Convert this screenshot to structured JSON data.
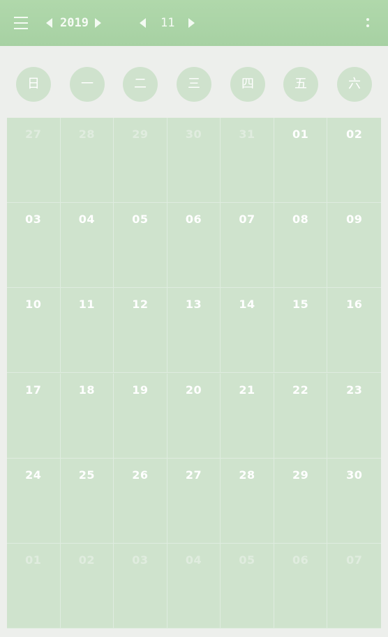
{
  "header": {
    "year": "2019",
    "month": "11",
    "icons": {
      "menu": "hamburger-menu-icon",
      "prev_year": "triangle-left-icon",
      "next_year": "triangle-right-icon",
      "prev_month": "triangle-left-icon",
      "next_month": "triangle-right-icon",
      "more": "vertical-dots-icon"
    }
  },
  "weekdays": [
    "日",
    "一",
    "二",
    "三",
    "四",
    "五",
    "六"
  ],
  "calendar": {
    "weeks": [
      [
        {
          "day": "27",
          "current": false
        },
        {
          "day": "28",
          "current": false
        },
        {
          "day": "29",
          "current": false
        },
        {
          "day": "30",
          "current": false
        },
        {
          "day": "31",
          "current": false
        },
        {
          "day": "01",
          "current": true
        },
        {
          "day": "02",
          "current": true
        }
      ],
      [
        {
          "day": "03",
          "current": true
        },
        {
          "day": "04",
          "current": true
        },
        {
          "day": "05",
          "current": true
        },
        {
          "day": "06",
          "current": true
        },
        {
          "day": "07",
          "current": true
        },
        {
          "day": "08",
          "current": true
        },
        {
          "day": "09",
          "current": true
        }
      ],
      [
        {
          "day": "10",
          "current": true
        },
        {
          "day": "11",
          "current": true
        },
        {
          "day": "12",
          "current": true
        },
        {
          "day": "13",
          "current": true
        },
        {
          "day": "14",
          "current": true
        },
        {
          "day": "15",
          "current": true
        },
        {
          "day": "16",
          "current": true
        }
      ],
      [
        {
          "day": "17",
          "current": true
        },
        {
          "day": "18",
          "current": true
        },
        {
          "day": "19",
          "current": true
        },
        {
          "day": "20",
          "current": true
        },
        {
          "day": "21",
          "current": true
        },
        {
          "day": "22",
          "current": true
        },
        {
          "day": "23",
          "current": true
        }
      ],
      [
        {
          "day": "24",
          "current": true
        },
        {
          "day": "25",
          "current": true
        },
        {
          "day": "26",
          "current": true
        },
        {
          "day": "27",
          "current": true
        },
        {
          "day": "28",
          "current": true
        },
        {
          "day": "29",
          "current": true
        },
        {
          "day": "30",
          "current": true
        }
      ],
      [
        {
          "day": "01",
          "current": false
        },
        {
          "day": "02",
          "current": false
        },
        {
          "day": "03",
          "current": false
        },
        {
          "day": "04",
          "current": false
        },
        {
          "day": "05",
          "current": false
        },
        {
          "day": "06",
          "current": false
        },
        {
          "day": "07",
          "current": false
        }
      ]
    ]
  },
  "colors": {
    "header_bg": "#a9d3a5",
    "page_bg": "#edefec",
    "cell_bg": "#cfe3cd",
    "weekday_circle": "#cfe2cd"
  }
}
